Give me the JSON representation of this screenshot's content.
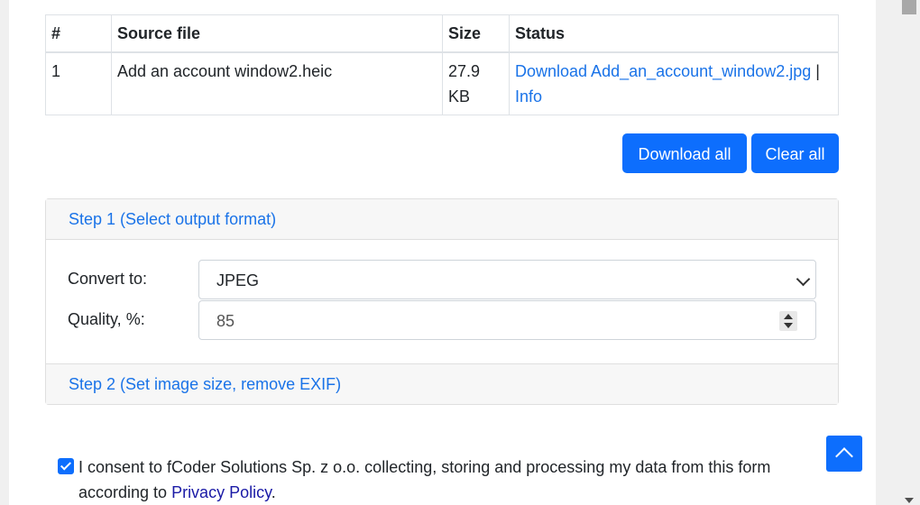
{
  "table": {
    "headers": [
      "#",
      "Source file",
      "Size",
      "Status"
    ],
    "rows": [
      {
        "num": "1",
        "source": "Add an account window2.heic",
        "size": "27.9 KB",
        "download_link": "Download Add_an_account_window2.jpg",
        "separator": "|",
        "info_link": "Info"
      }
    ]
  },
  "buttons": {
    "download_all": "Download all",
    "clear_all": "Clear all"
  },
  "step1": {
    "title": "Step 1 (Select output format)",
    "convert_label": "Convert to:",
    "convert_value": "JPEG",
    "quality_label": "Quality, %:",
    "quality_value": "85"
  },
  "step2": {
    "title": "Step 2 (Set image size, remove EXIF)"
  },
  "consent": {
    "text": "I consent to fCoder Solutions Sp. z o.o. collecting, storing and processing my data from this form according to ",
    "link": "Privacy Policy",
    "end": "."
  },
  "icons": {
    "to_top": "chevron-up-icon",
    "select": "chevron-down-icon",
    "checkbox": "checkmark-icon"
  },
  "colors": {
    "primary": "#0d6efd",
    "link": "#1a73e8"
  }
}
